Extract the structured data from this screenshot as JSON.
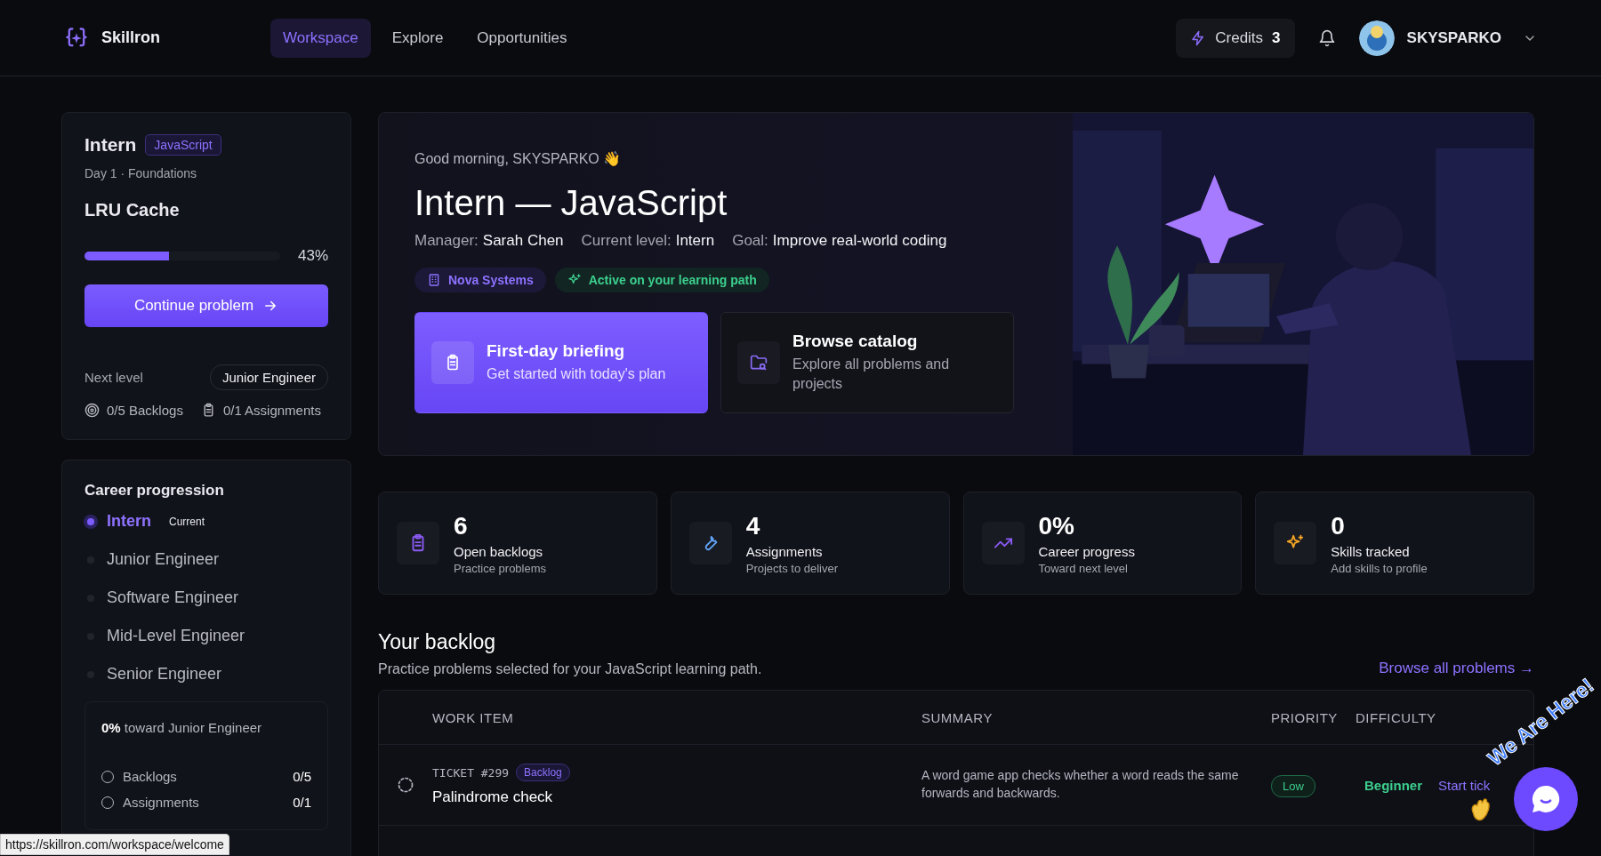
{
  "header": {
    "brand": "Skillron",
    "nav": [
      {
        "label": "Workspace",
        "selected": true
      },
      {
        "label": "Explore",
        "selected": false
      },
      {
        "label": "Opportunities",
        "selected": false
      }
    ],
    "credits_label": "Credits",
    "credits_value": "3",
    "username": "SKYSPARKO"
  },
  "current_card": {
    "role": "Intern",
    "language": "JavaScript",
    "day": "Day 1 · Foundations",
    "problem": "LRU Cache",
    "progress": {
      "level": 0.43,
      "reading": "43%"
    },
    "button": "Continue problem",
    "next_level_label": "Next level",
    "next_level": "Junior Engineer",
    "backlogs": "0/5 Backlogs",
    "assignments": "0/1 Assignments"
  },
  "career": {
    "title": "Career progression",
    "steps": [
      {
        "label": "Intern",
        "selected": true,
        "tag": "Current"
      },
      {
        "label": "Junior Engineer",
        "selected": false
      },
      {
        "label": "Software Engineer",
        "selected": false
      },
      {
        "label": "Mid-Level Engineer",
        "selected": false
      },
      {
        "label": "Senior Engineer",
        "selected": false
      }
    ],
    "summary": "**0%** toward Junior Engineer",
    "requirements": [
      {
        "label": "Backlogs",
        "value": "0/5",
        "checked": false
      },
      {
        "label": "Assignments",
        "value": "0/1",
        "checked": false
      }
    ]
  },
  "hero": {
    "greeting": "Good morning, SKYSPARKO 👋",
    "title": "Intern — JavaScript",
    "meta": [
      {
        "label": "Manager:",
        "value": "Sarah Chen"
      },
      {
        "label": "Current level:",
        "value": "Intern"
      },
      {
        "label": "Goal:",
        "value": "Improve real-world coding"
      }
    ],
    "company": "Nova Systems",
    "status": "Active on your learning path",
    "actions": [
      {
        "title": "First-day briefing",
        "text": "Get started with today's plan",
        "selected": true
      },
      {
        "title": "Browse catalog",
        "text": "Explore all problems and projects",
        "selected": false
      }
    ]
  },
  "stats": [
    {
      "value": "6",
      "label": "Open backlogs",
      "sub": "Practice problems",
      "color": "#8b5cf6"
    },
    {
      "value": "4",
      "label": "Assignments",
      "sub": "Projects to deliver",
      "color": "#60a5fa"
    },
    {
      "value": "0%",
      "label": "Career progress",
      "sub": "Toward next level",
      "color": "#8b5cf6"
    },
    {
      "value": "0",
      "label": "Skills tracked",
      "sub": "Add skills to profile",
      "color": "#f5a524"
    }
  ],
  "backlog": {
    "title": "Your backlog",
    "subtitle": "Practice problems selected for your JavaScript learning path.",
    "link": "Browse all problems →",
    "columns": [
      "WORK ITEM",
      "SUMMARY",
      "PRIORITY",
      "DIFFICULTY"
    ],
    "rows": [
      {
        "ticket": "TICKET #299",
        "status": "Backlog",
        "title": "Palindrome check",
        "summary": "A word game app checks whether a word reads the same forwards and backwards.",
        "priority": "Low",
        "difficulty": "Beginner",
        "action": "Start tick"
      }
    ]
  },
  "chat_widget": {
    "caption": "We Are Here!"
  },
  "status_url": "https://skillron.com/workspace/welcome"
}
